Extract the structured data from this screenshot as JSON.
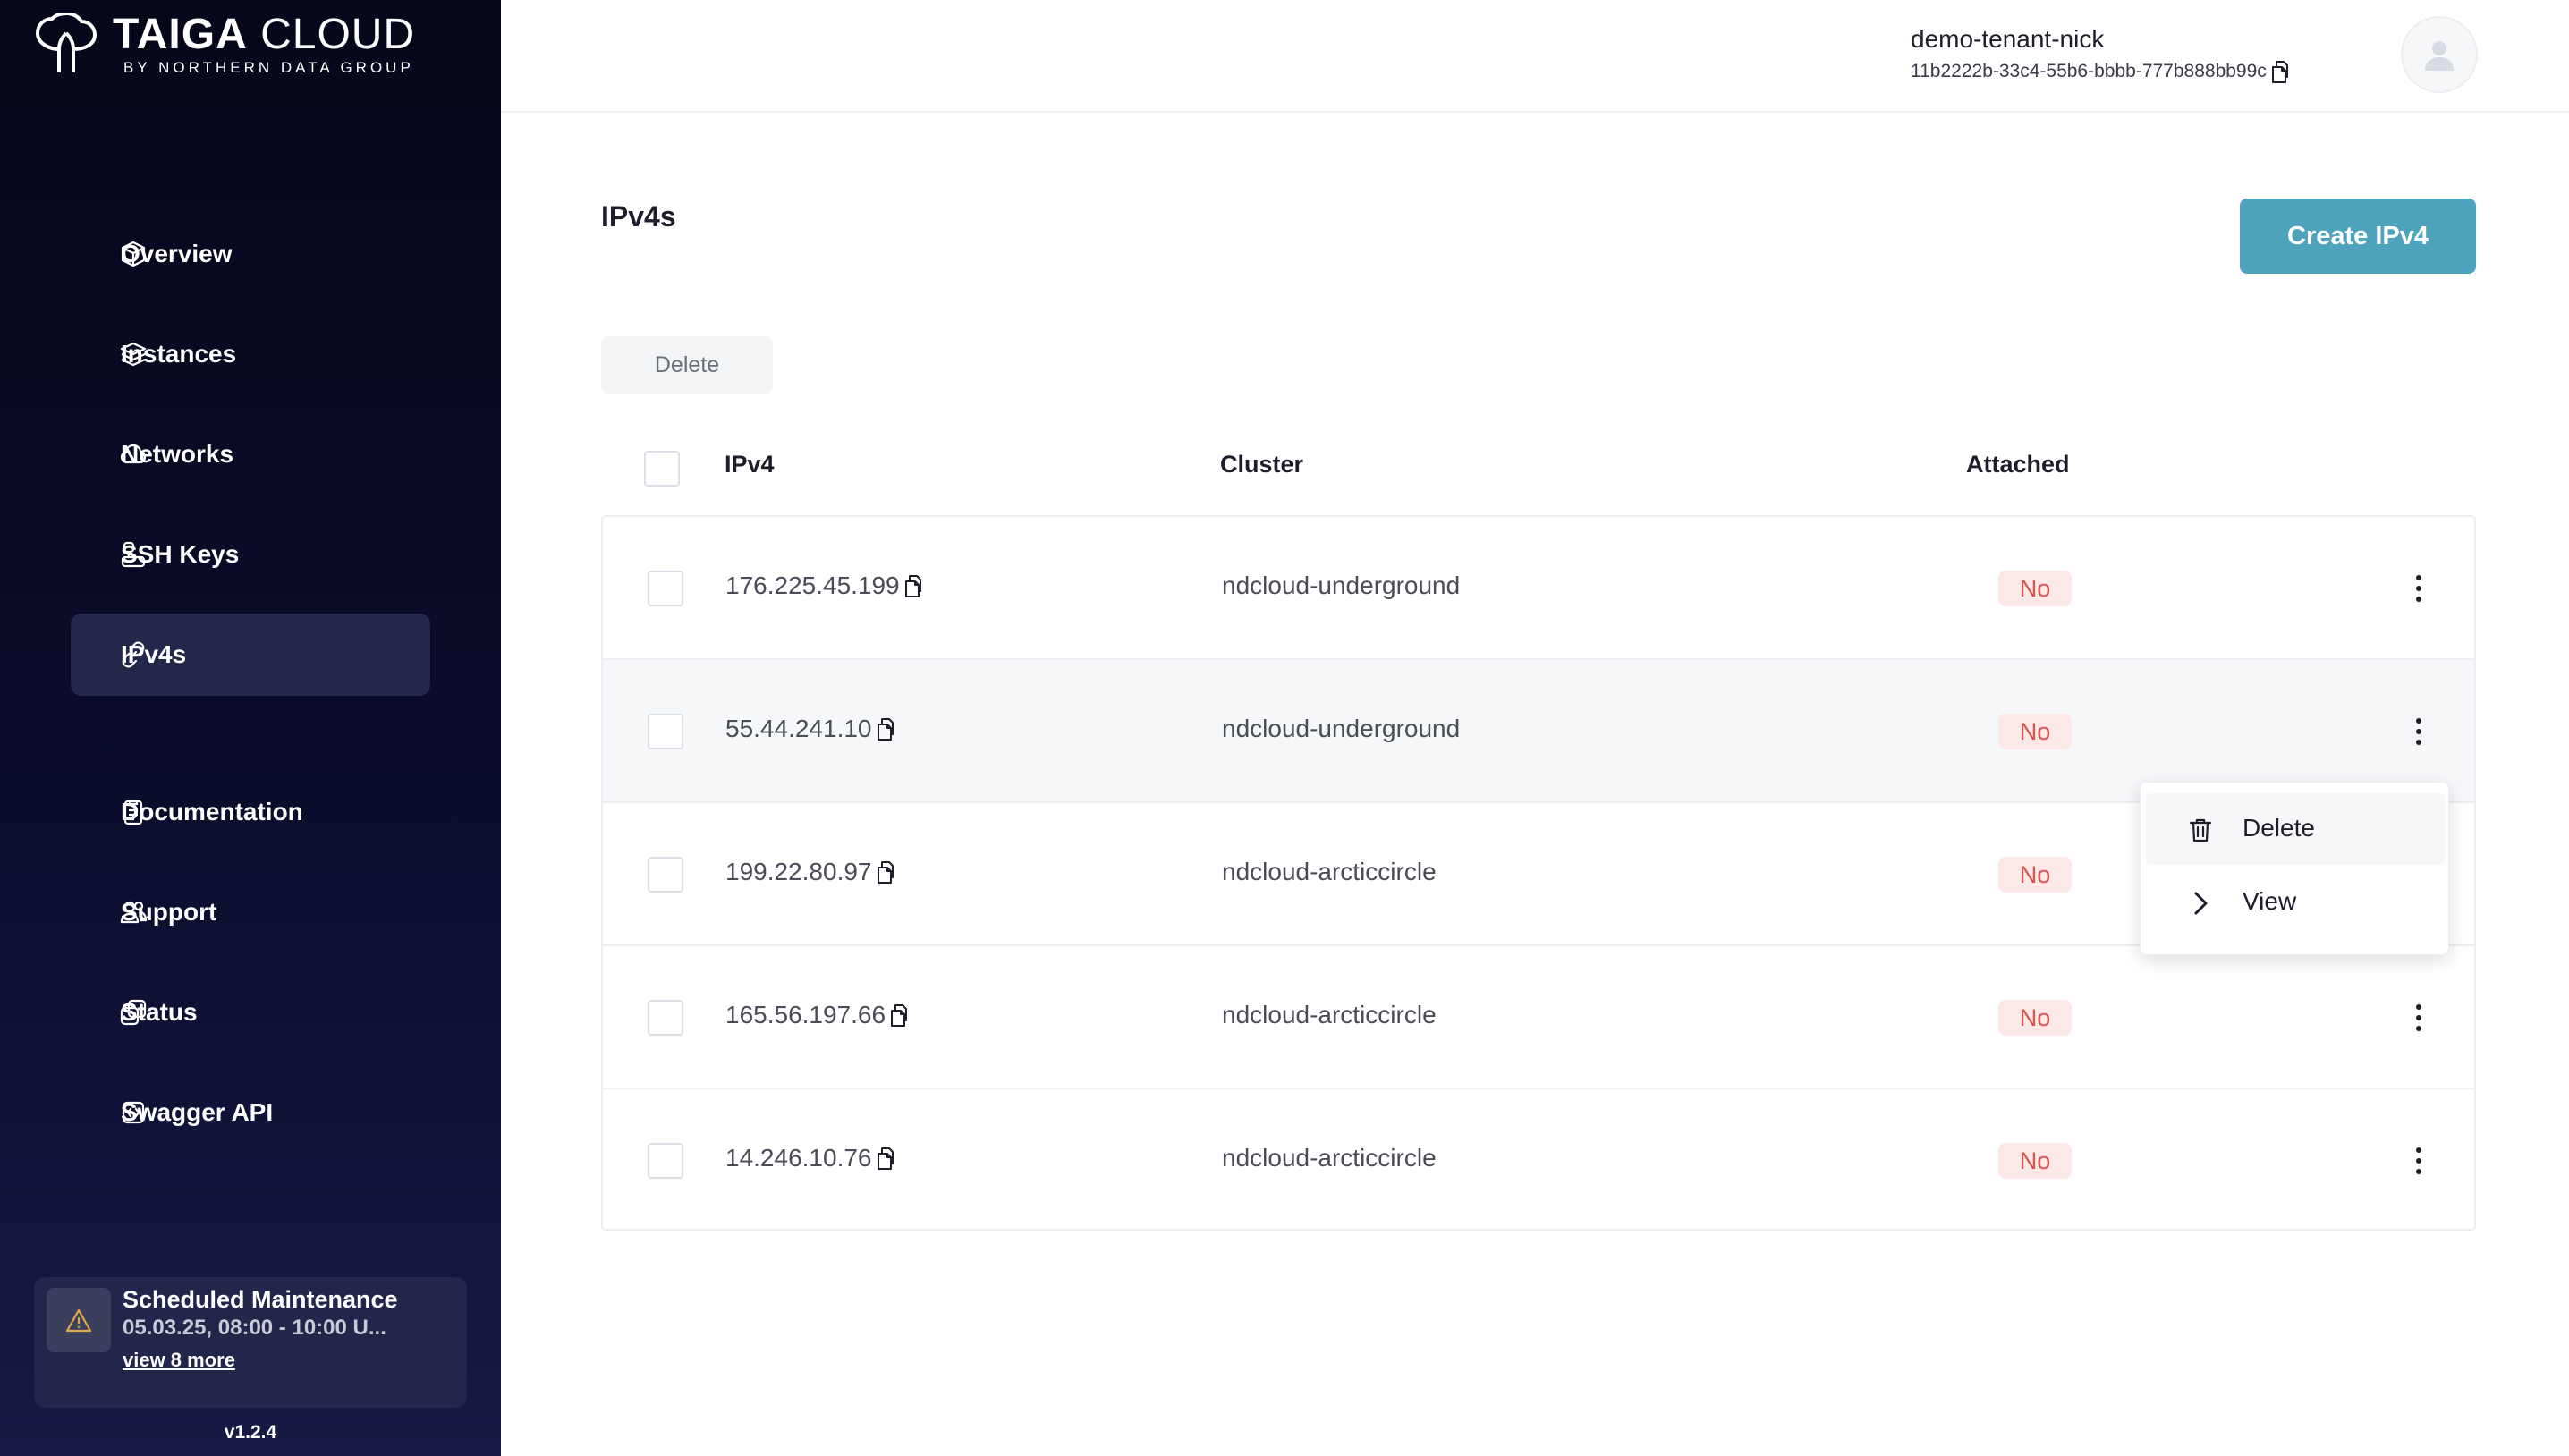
{
  "brand": {
    "title_bold": "TAIGA",
    "title_light": "CLOUD",
    "subtitle": "BY NORTHERN DATA GROUP"
  },
  "sidebar": {
    "items": [
      {
        "label": "Overview",
        "icon": "cube-icon"
      },
      {
        "label": "Instances",
        "icon": "layers-icon"
      },
      {
        "label": "Networks",
        "icon": "cloud-icon"
      },
      {
        "label": "SSH Keys",
        "icon": "key-icon"
      },
      {
        "label": "IPv4s",
        "icon": "link-icon",
        "active": true
      },
      {
        "label": "Documentation",
        "icon": "document-icon"
      },
      {
        "label": "Support",
        "icon": "users-icon"
      },
      {
        "label": "Status",
        "icon": "status-icon"
      },
      {
        "label": "Swagger API",
        "icon": "code-icon"
      }
    ],
    "maintenance": {
      "title": "Scheduled Maintenance",
      "date": "05.03.25, 08:00 - 10:00 U...",
      "link": "view 8 more"
    },
    "version": "v1.2.4"
  },
  "header": {
    "tenant_name": "demo-tenant-nick",
    "tenant_id": "11b2222b-33c4-55b6-bbbb-777b888bb99c"
  },
  "main": {
    "title": "IPv4s",
    "create_label": "Create IPv4",
    "delete_label": "Delete",
    "table": {
      "columns": [
        "IPv4",
        "Cluster",
        "Attached"
      ],
      "rows": [
        {
          "ipv4": "176.225.45.199",
          "cluster": "ndcloud-underground",
          "attached": "No"
        },
        {
          "ipv4": "55.44.241.10",
          "cluster": "ndcloud-underground",
          "attached": "No"
        },
        {
          "ipv4": "199.22.80.97",
          "cluster": "ndcloud-arcticcircle",
          "attached": "No"
        },
        {
          "ipv4": "165.56.197.66",
          "cluster": "ndcloud-arcticcircle",
          "attached": "No"
        },
        {
          "ipv4": "14.246.10.76",
          "cluster": "ndcloud-arcticcircle",
          "attached": "No"
        }
      ]
    },
    "row_menu": {
      "delete_label": "Delete",
      "view_label": "View"
    }
  },
  "colors": {
    "accent": "#4ea3bc",
    "sidebar_bg": "#0b0d2c",
    "badge_bg": "#fde8e8",
    "badge_text": "#d9534f"
  }
}
